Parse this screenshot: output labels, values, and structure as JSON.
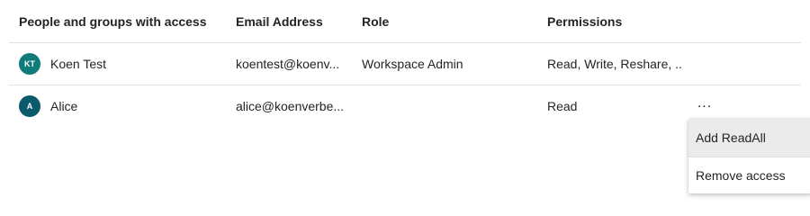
{
  "columns": {
    "name": "People and groups with access",
    "email": "Email Address",
    "role": "Role",
    "permissions": "Permissions"
  },
  "rows": [
    {
      "initials": "KT",
      "avatar_color": "#0f7b7b",
      "name": "Koen Test",
      "email": "koentest@koenv...",
      "role": "Workspace Admin",
      "permissions": "Read, Write, Reshare, ..."
    },
    {
      "initials": "A",
      "avatar_color": "#0b5a6b",
      "name": "Alice",
      "email": "alice@koenverbe...",
      "role": "",
      "permissions": "Read",
      "more": "..."
    }
  ],
  "context_menu": {
    "items": [
      "Add ReadAll",
      "Remove access"
    ]
  }
}
